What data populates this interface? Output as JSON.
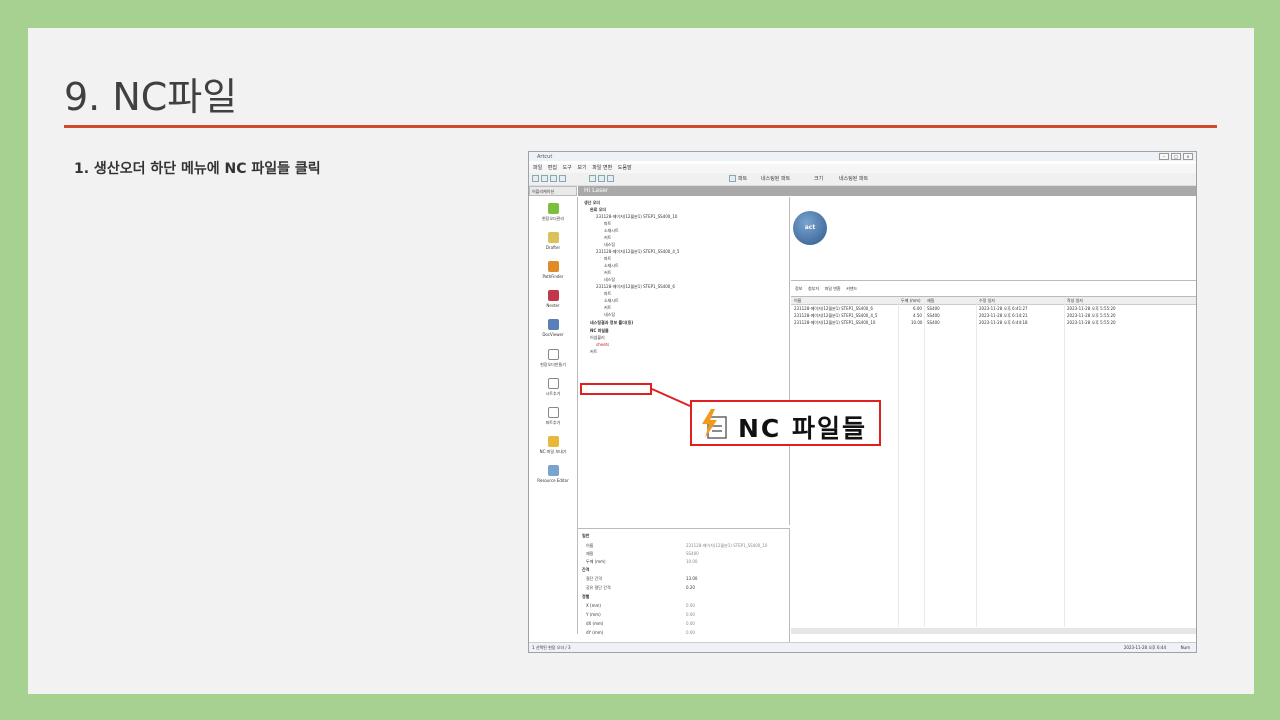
{
  "slide": {
    "title": "9. NC파일",
    "step": "1.  생산오더 하단 메뉴에 NC 파일들 클릭"
  },
  "app": {
    "window_title": "Artcut",
    "menu": [
      "파일",
      "편집",
      "도구",
      "보기",
      "파일 변환",
      "도움말"
    ],
    "toolbar_labels": [
      "파트",
      "네스팅된 파트",
      "크기",
      "네스팅된 파트"
    ],
    "nav_header": "어플리케이션",
    "brand_bar": "Hi Laser",
    "nav_items": [
      "현장오더관리",
      "Drafter",
      "PathFinder",
      "Nester",
      "DocViewer",
      "현장오더만들기",
      "시트추가",
      "파트추가",
      "NC 파일 보내기",
      "Resource Editor"
    ],
    "tree": {
      "l0": "생산 오더",
      "l1": "완료 오더",
      "order1": "231128-메이저(12월분1) STEP1_SS400_10",
      "order2": "231128-메이저(12월분1) STEP1_SS400_4_5",
      "order3": "231128-메이저(12월분1) STEP1_SS400_6",
      "c_part": "파트",
      "c_sheet": "소재시트",
      "c_cut": "커트",
      "c_nest": "네스팅",
      "nest_result": "네스팅결과 정보 폴더(등)",
      "nc_files": "NC 파일들",
      "asmbly": "어셈블리",
      "sheets": "sheets",
      "cut2": "커트"
    },
    "props": {
      "sec_general": "일반",
      "name_k": "이름",
      "name_v": "231128-메이저(12월분1) STEP1_SS400_10",
      "mat_k": "재질",
      "mat_v": "SS400",
      "thk_k": "두께 (mm)",
      "thk_v": "10.00",
      "sec_gap": "간격",
      "gap_k": "절단 간격",
      "gap_v": "13.00",
      "cgap_k": "공유 절단 간격",
      "cgap_v": "0.20",
      "sec_align": "정렬",
      "x_k": "X (mm)",
      "x_v": "0.00",
      "y_k": "Y (mm)",
      "y_v": "0.00",
      "dx_k": "dX (mm)",
      "dx_v": "0.00",
      "dy_k": "dY (mm)",
      "dy_v": "0.00"
    },
    "preview_logo": "act",
    "tabs": [
      "정보",
      "첨부자",
      "파일 변환",
      "커맨드"
    ],
    "columns": [
      "이름",
      "두께 (mm)",
      "재질",
      "수정 일자",
      "작성 일자"
    ],
    "rows": [
      {
        "name": "231128-메이저(12월분1) STEP1_SS400_6",
        "thk": "6.00",
        "mat": "SS400",
        "mod": "2023-11-28 오후 6:41:27",
        "crt": "2023-11-28 오후 5:55:20"
      },
      {
        "name": "231128-메이저(12월분1) STEP1_SS400_4_5",
        "thk": "4.50",
        "mat": "SS400",
        "mod": "2023-11-28 오후 6:14:21",
        "crt": "2023-11-28 오후 5:55:20"
      },
      {
        "name": "231128-메이저(12월분1) STEP1_SS400_10",
        "thk": "10.00",
        "mat": "SS400",
        "mod": "2023-11-28 오후 6:44:18",
        "crt": "2023-11-28 오후 5:55:20"
      }
    ],
    "status_left": "1 선택된 현장 오더 / 3",
    "status_right": "2023-11-28 오후 6:44",
    "status_num": "Num"
  },
  "callout": {
    "label": "NC 파일들"
  },
  "colors": {
    "background": "#a7d191",
    "accent_rule": "#d04a32",
    "highlight": "#e02020"
  }
}
